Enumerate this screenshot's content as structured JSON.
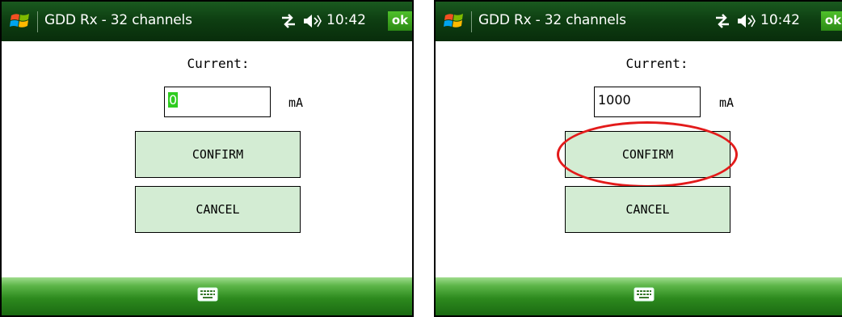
{
  "screens": [
    {
      "title": "GDD Rx - 32 channels",
      "clock": "10:42",
      "ok_label": "ok",
      "current_label": "Current:",
      "current_value": "0",
      "current_value_selected": true,
      "unit": "mA",
      "confirm_label": "CONFIRM",
      "cancel_label": "CANCEL",
      "confirm_highlighted": false
    },
    {
      "title": "GDD Rx - 32 channels",
      "clock": "10:42",
      "ok_label": "ok",
      "current_label": "Current:",
      "current_value": "1000",
      "current_value_selected": false,
      "unit": "mA",
      "confirm_label": "CONFIRM",
      "cancel_label": "CANCEL",
      "confirm_highlighted": true
    }
  ],
  "icons": {
    "start": "windows-logo-icon",
    "connectivity": "connectivity-arrows-icon",
    "volume": "speaker-volume-icon",
    "keyboard": "keyboard-icon"
  },
  "colors": {
    "titlebar": "#0e3f12",
    "ok_button": "#3aa51f",
    "button_fill": "#d3ecd3",
    "selection": "#2ecc1f",
    "highlight_ring": "#e31b1b",
    "bottombar": "#2d8a1e"
  }
}
